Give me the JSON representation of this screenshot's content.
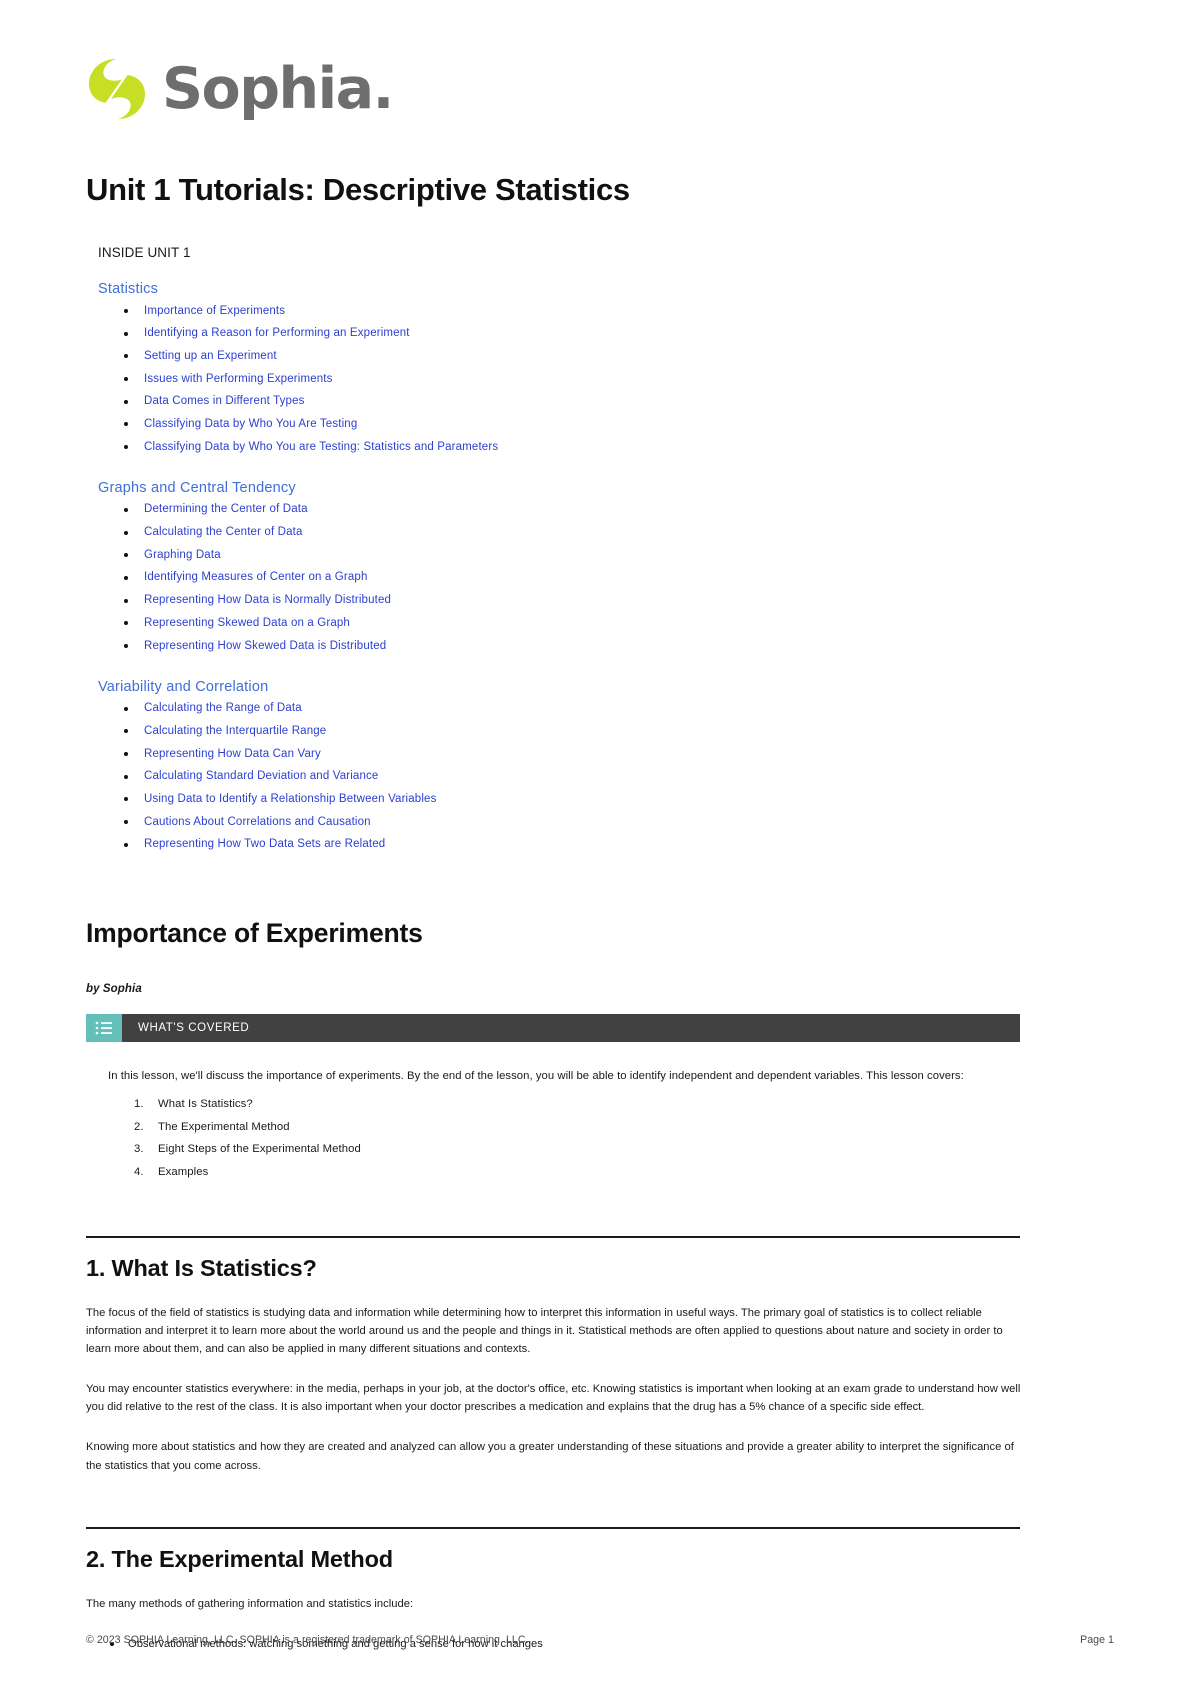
{
  "brand": {
    "name": "Sophia",
    "logo_icon": "sophia-leaf-logo",
    "logo_color": "#c6de23",
    "wordmark_color": "#6e6e6e"
  },
  "header": {
    "title": "Unit 1 Tutorials: Descriptive Statistics"
  },
  "toc": {
    "label": "INSIDE UNIT 1",
    "sections": [
      {
        "title": "Statistics",
        "items": [
          "Importance of Experiments",
          "Identifying a Reason for Performing an Experiment",
          "Setting up an Experiment",
          "Issues with Performing Experiments",
          "Data Comes in Different Types",
          "Classifying Data by Who You Are Testing",
          "Classifying Data by Who You are Testing: Statistics and Parameters"
        ]
      },
      {
        "title": "Graphs and Central Tendency",
        "items": [
          "Determining the Center of Data",
          "Calculating the Center of Data",
          "Graphing Data",
          "Identifying Measures of Center on a Graph",
          "Representing How Data is Normally Distributed",
          "Representing Skewed Data on a Graph",
          "Representing How Skewed Data is Distributed"
        ]
      },
      {
        "title": "Variability and Correlation",
        "items": [
          "Calculating the Range of Data",
          "Calculating the Interquartile Range",
          "Representing How Data Can Vary",
          "Calculating Standard Deviation and Variance",
          "Using Data to Identify a Relationship Between Variables",
          "Cautions About Correlations and Causation",
          "Representing How Two Data Sets are Related"
        ]
      }
    ]
  },
  "lesson": {
    "title": "Importance of Experiments",
    "byline": "by Sophia"
  },
  "callout": {
    "icon": "list-icon",
    "label": "WHAT'S COVERED",
    "accent_color": "#63bfb7",
    "bar_color": "#414141",
    "intro": "In this lesson, we'll discuss the importance of experiments. By the end of the lesson, you will be able to identify independent and dependent variables. This lesson covers:",
    "objectives": [
      "What Is Statistics?",
      "The Experimental Method",
      "Eight Steps of the Experimental Method",
      "Examples"
    ]
  },
  "sections": [
    {
      "heading": "1. What Is Statistics?",
      "paragraphs": [
        "The focus of the field of statistics is studying data and information while determining how to interpret this information in useful ways. The primary goal of statistics is to collect reliable information and interpret it to learn more about the world around us and the people and things in it. Statistical methods are often applied to questions about nature and society in order to learn more about them, and can also be applied in many different situations and contexts.",
        "You may encounter statistics everywhere: in the media, perhaps in your job, at the doctor's office, etc. Knowing statistics is important when looking at an exam grade to understand how well you did relative to the rest of the class. It is also important when your doctor prescribes a medication and explains that the drug has a 5% chance of a specific side effect.",
        "Knowing more about statistics and how they are created and analyzed can allow you a greater understanding of these situations and provide a greater ability to interpret the significance of the statistics that you come across."
      ]
    },
    {
      "heading": "2. The Experimental Method",
      "paragraphs": [
        "The many methods of gathering information and statistics include:"
      ],
      "bullets": [
        "Observational methods: watching something and getting a sense for how it changes"
      ]
    }
  ],
  "footer": {
    "copyright": "© 2023 SOPHIA Learning, LLC. SOPHIA is a registered trademark of SOPHIA Learning, LLC.",
    "page": "Page 1"
  }
}
